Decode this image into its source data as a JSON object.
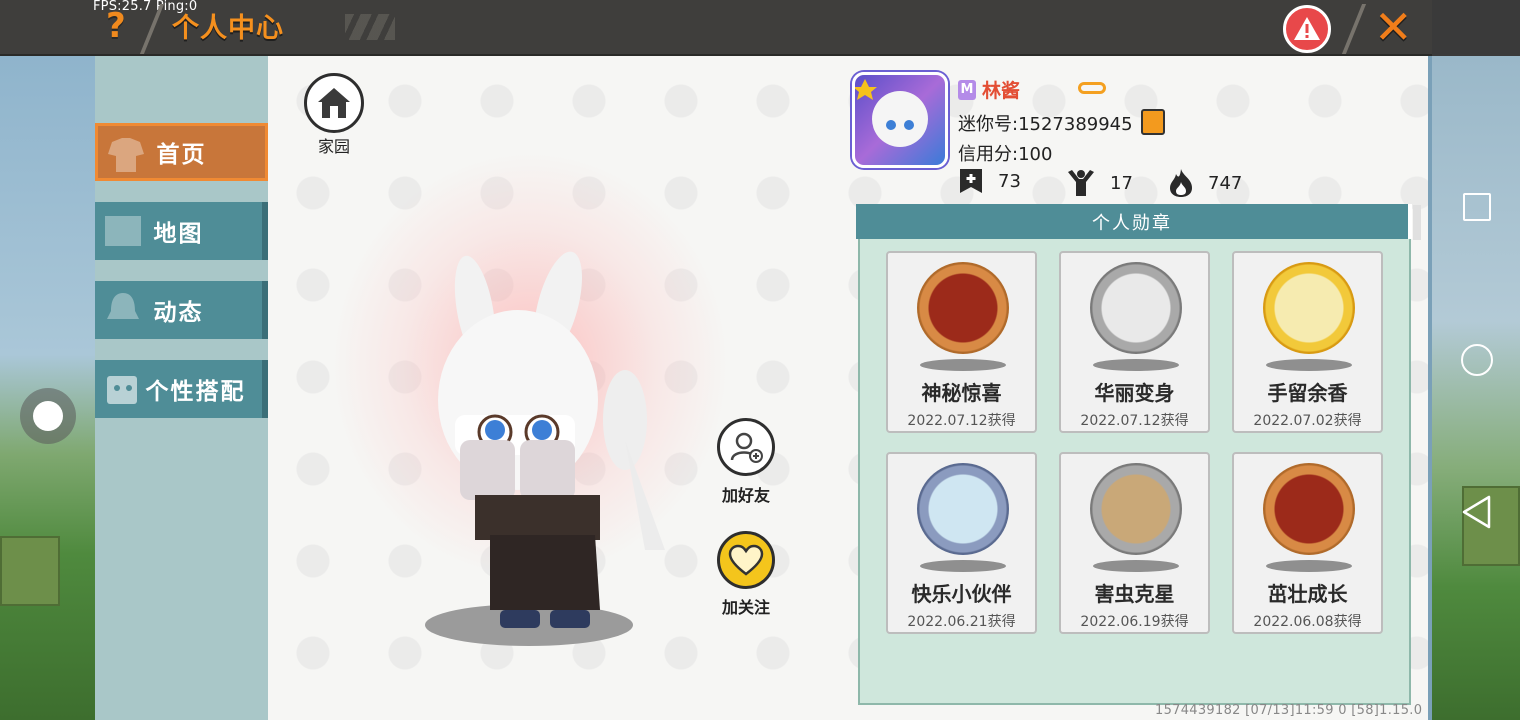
{
  "status": {
    "fps_ping": "FPS:25.7  Ping:0"
  },
  "header": {
    "help_glyph": "?",
    "title": "个人中心",
    "close_glyph": "✕"
  },
  "sidebar": {
    "items": [
      {
        "label": "首页",
        "active": true
      },
      {
        "label": "地图",
        "active": false
      },
      {
        "label": "动态",
        "active": false
      },
      {
        "label": "个性搭配",
        "active": false
      }
    ]
  },
  "main": {
    "home_label": "家园",
    "add_friend_label": "加好友",
    "follow_label": "加关注"
  },
  "profile": {
    "name": "林酱",
    "mini_id": "迷你号:1527389945",
    "credit": "信用分:100",
    "stats": [
      {
        "icon": "bookmark-plus-icon",
        "value": "73"
      },
      {
        "icon": "cheer-person-icon",
        "value": "17"
      },
      {
        "icon": "flame-icon",
        "value": "747"
      }
    ]
  },
  "medals": {
    "title": "个人勋章",
    "items": [
      {
        "name": "神秘惊喜",
        "date": "2022.07.12获得",
        "rim": "#b06a2a",
        "face": "#9c2a1a"
      },
      {
        "name": "华丽变身",
        "date": "2022.07.12获得",
        "rim": "#8a8a8a",
        "face": "#d9d9d9"
      },
      {
        "name": "手留余香",
        "date": "2022.07.02获得",
        "rim": "#e8b21a",
        "face": "#f6df8a"
      },
      {
        "name": "快乐小伙伴",
        "date": "2022.06.21获得",
        "rim": "#6f7fa5",
        "face": "#cfe0ea"
      },
      {
        "name": "害虫克星",
        "date": "2022.06.19获得",
        "rim": "#8a8a8a",
        "face": "#b9a07a"
      },
      {
        "name": "茁壮成长",
        "date": "2022.06.08获得",
        "rim": "#b06a2a",
        "face": "#9c2a1a"
      }
    ]
  },
  "footer": {
    "text": "1574439182   [07/13]11:59 0   [58]1.15.0"
  },
  "colors": {
    "accent": "#f08a1e",
    "teal": "#4f8d97",
    "panel": "#cfe7dc"
  }
}
